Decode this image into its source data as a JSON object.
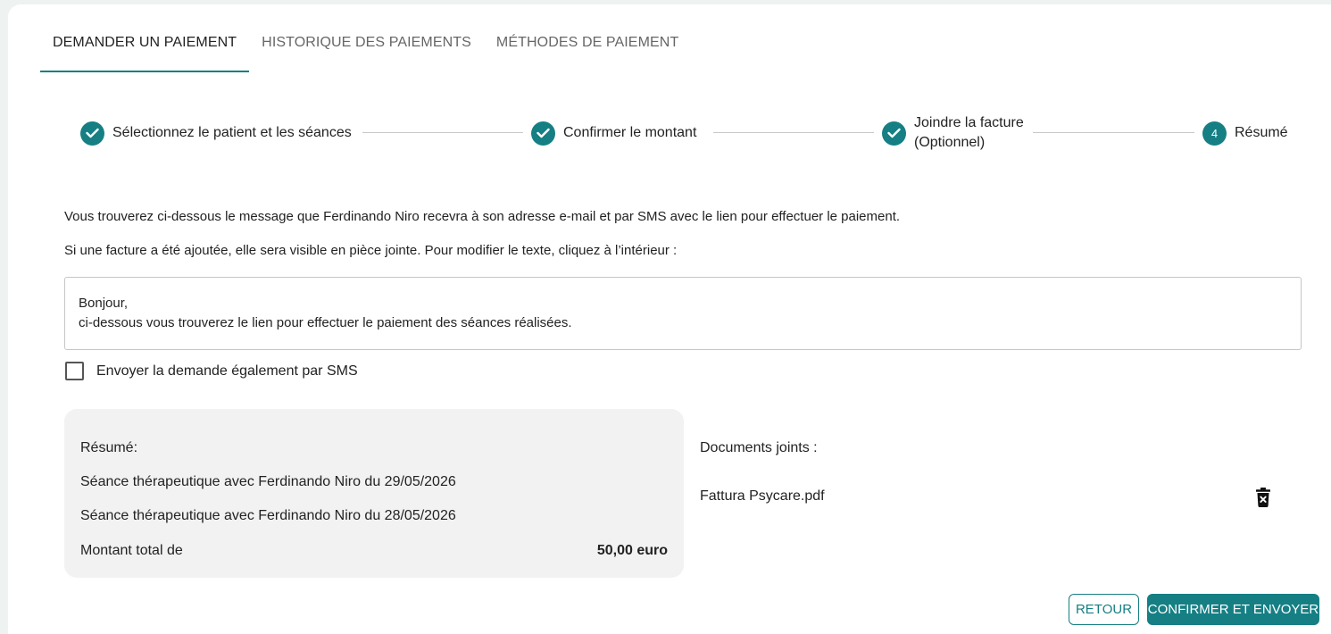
{
  "tabs": [
    {
      "label": "DEMANDER UN PAIEMENT",
      "active": true
    },
    {
      "label": "HISTORIQUE DES PAIEMENTS",
      "active": false
    },
    {
      "label": "MÉTHODES DE PAIEMENT",
      "active": false
    }
  ],
  "stepper": {
    "steps": [
      {
        "label": "Sélectionnez le patient et les séances",
        "status": "done",
        "icon": "check-icon"
      },
      {
        "label_line1": "Confirmer le montant",
        "status": "done",
        "icon": "check-icon"
      },
      {
        "label_line1": "Joindre la facture",
        "label_line2": "(Optionnel)",
        "status": "done",
        "icon": "check-icon"
      },
      {
        "number": "4",
        "label": "Résumé",
        "status": "current"
      }
    ]
  },
  "intro": {
    "line1": "Vous trouverez ci-dessous le message que Ferdinando Niro recevra à son adresse e-mail et par SMS avec le lien pour effectuer le paiement.",
    "line2": "Si une facture a été ajoutée, elle sera visible en pièce jointe. Pour modifier le texte, cliquez à l’intérieur :"
  },
  "message": {
    "line1": "Bonjour,",
    "line2": "ci-dessous vous trouverez le lien pour effectuer le paiement des séances réalisées."
  },
  "sms_checkbox": {
    "label": "Envoyer la demande également par SMS",
    "checked": false
  },
  "summary": {
    "title": "Résumé:",
    "items": [
      "Séance thérapeutique avec Ferdinando Niro du 29/05/2026",
      "Séance thérapeutique avec Ferdinando Niro du 28/05/2026"
    ],
    "total_label": "Montant total de",
    "total_value": "50,00 euro"
  },
  "documents": {
    "title": "Documents joints :",
    "files": [
      "Fattura Psycare.pdf"
    ]
  },
  "buttons": {
    "back": "RETOUR",
    "confirm": "CONFIRMER ET ENVOYER"
  },
  "colors": {
    "accent": "#157f84",
    "summary_bg": "#f2f2f2"
  }
}
